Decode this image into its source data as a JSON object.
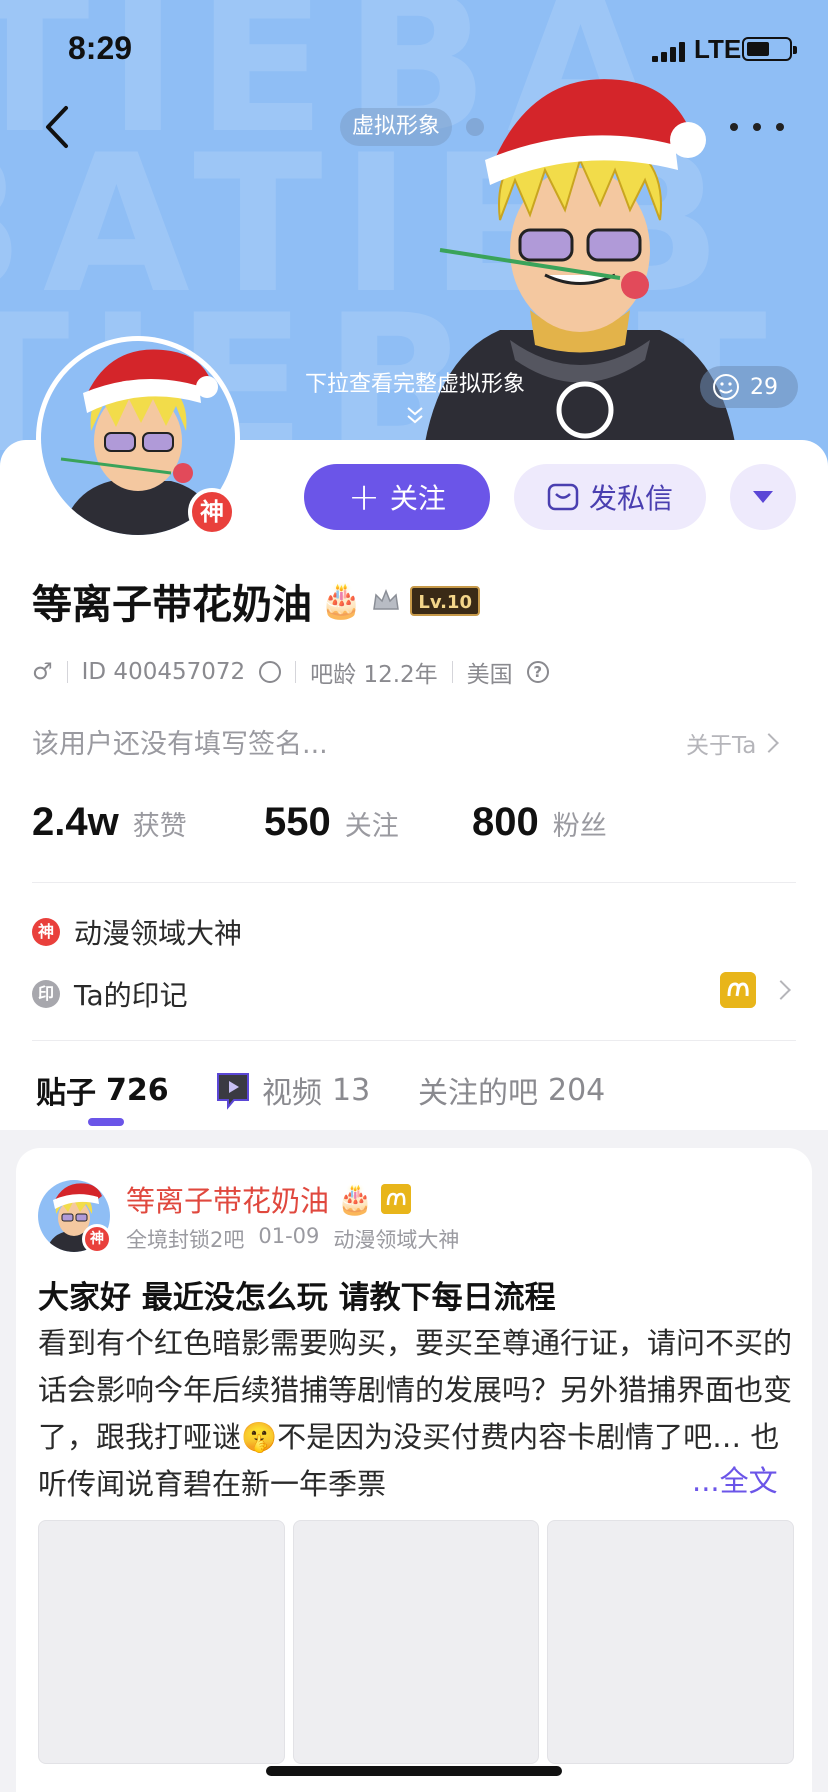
{
  "status_bar": {
    "time": "8:29",
    "network": "LTE"
  },
  "header": {
    "avatar_pill": "虚拟形象",
    "pull_hint": "下拉查看完整虚拟形象",
    "mood_count": "29"
  },
  "profile": {
    "name": "等离子带花奶油",
    "name_emoji": "🎂",
    "level": "Lv.10",
    "shen_badge": "神",
    "follow_label": "关注",
    "dm_label": "发私信",
    "gender": "♂",
    "id_text": "ID 400457072",
    "age_text": "吧龄 12.2年",
    "location": "美国",
    "signature": "该用户还没有填写签名...",
    "about_label": "关于Ta"
  },
  "stats": [
    {
      "num": "2.4w",
      "label": "获赞"
    },
    {
      "num": "550",
      "label": "关注"
    },
    {
      "num": "800",
      "label": "粉丝"
    }
  ],
  "honors": {
    "shen_badge": "神",
    "shen_label": "动漫领域大神",
    "mark_badge": "印",
    "mark_label": "Ta的印记"
  },
  "tabs": [
    {
      "label": "贴子",
      "count": "726"
    },
    {
      "label": "视频",
      "count": "13"
    },
    {
      "label": "关注的吧",
      "count": "204"
    }
  ],
  "post": {
    "author": "等离子带花奶油",
    "author_emoji": "🎂",
    "shen_badge": "神",
    "meta_1": "全境封锁2吧",
    "meta_2": "01-09",
    "meta_3": "动漫领域大神",
    "title": "大家好 最近没怎么玩 请教下每日流程",
    "body": "看到有个红色暗影需要购买，要买至尊通行证，请问不买的话会影响今年后续猎捕等剧情的发展吗？另外猎捕界面也变了，跟我打哑谜🤫不是因为没买付费内容卡剧情了吧… 也听传闻说育碧在新一年季票",
    "read_more": "...全文"
  },
  "colors": {
    "accent": "#6b55e8",
    "hero_bg": "#8fbef5",
    "shen_red": "#e9403c",
    "mark_gold": "#e8b51a"
  }
}
